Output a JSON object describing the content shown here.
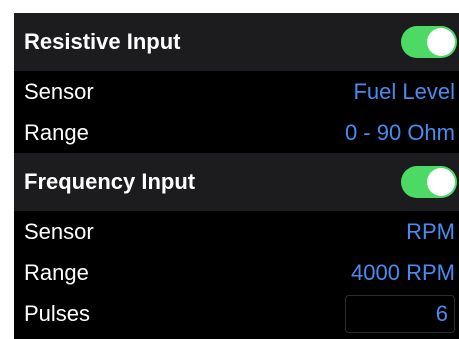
{
  "colors": {
    "header_bg": "#1c1c1e",
    "row_bg": "#000000",
    "label_text": "#ffffff",
    "value_text": "#4a8bf0",
    "toggle_on": "#4cd964"
  },
  "resistive": {
    "title": "Resistive Input",
    "toggle_on": true,
    "sensor_label": "Sensor",
    "sensor_value": "Fuel Level",
    "range_label": "Range",
    "range_value": "0 - 90 Ohm"
  },
  "frequency": {
    "title": "Frequency Input",
    "toggle_on": true,
    "sensor_label": "Sensor",
    "sensor_value": "RPM",
    "range_label": "Range",
    "range_value": "4000 RPM",
    "pulses_label": "Pulses",
    "pulses_value": "6"
  }
}
